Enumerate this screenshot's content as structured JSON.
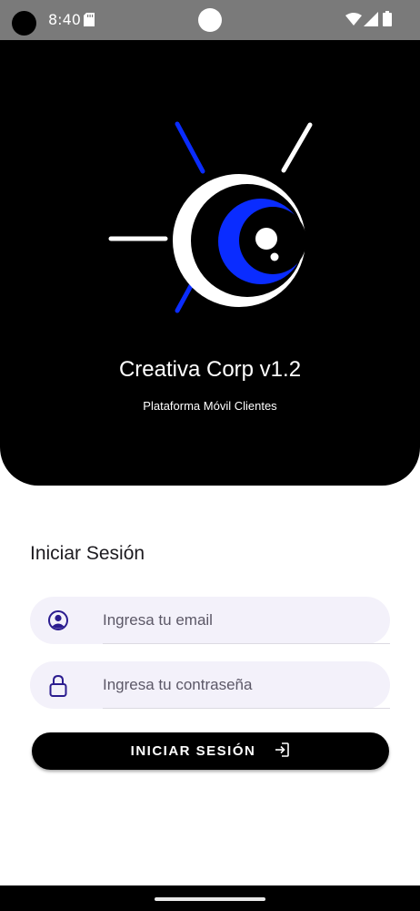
{
  "status_bar": {
    "time": "8:40",
    "icons": [
      "sd-card-icon",
      "wifi-icon",
      "signal-icon",
      "battery-icon"
    ]
  },
  "hero": {
    "title": "Creativa Corp v1.2",
    "subtitle": "Plataforma Móvil Clientes",
    "logo_icon": "eye-logo-icon",
    "colors": {
      "background": "#000000",
      "accent": "#0a2cff"
    }
  },
  "login": {
    "title": "Iniciar Sesión",
    "email": {
      "placeholder": "Ingresa tu email",
      "value": "",
      "icon": "user-circle-icon"
    },
    "password": {
      "placeholder": "Ingresa tu contraseña",
      "value": "",
      "icon": "lock-icon"
    },
    "button_label": "INICIAR SESIÓN",
    "button_icon": "login-arrow-icon",
    "colors": {
      "field_background": "#f3f1fa",
      "icon": "#2b1c8f",
      "button": "#000000"
    }
  }
}
